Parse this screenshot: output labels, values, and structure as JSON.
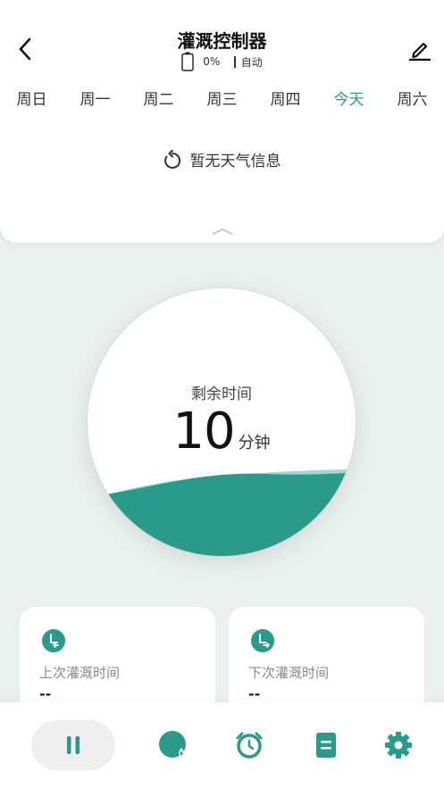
{
  "header": {
    "title": "灌溉控制器",
    "battery": "0%",
    "mode": "自动"
  },
  "days": [
    {
      "label": "周日",
      "active": false
    },
    {
      "label": "周一",
      "active": false
    },
    {
      "label": "周二",
      "active": false
    },
    {
      "label": "周三",
      "active": false
    },
    {
      "label": "周四",
      "active": false
    },
    {
      "label": "今天",
      "active": true
    },
    {
      "label": "周六",
      "active": false
    }
  ],
  "weather": {
    "text": "暂无天气信息"
  },
  "dial": {
    "label": "剩余时间",
    "value": "10",
    "unit": "分钟"
  },
  "cards": {
    "last": {
      "label": "上次灌溉时间",
      "value": "--"
    },
    "next": {
      "label": "下次灌溉时间",
      "value": "--"
    }
  },
  "icons": {
    "back": "chevron-left-icon",
    "edit": "pencil-icon",
    "battery": "battery-icon",
    "refresh": "refresh-icon",
    "collapse": "chevron-up-icon",
    "last_time": "clock-back-icon",
    "next_time": "clock-forward-icon",
    "pause": "pause-icon",
    "water": "water-drop-icon",
    "alarm": "alarm-clock-icon",
    "log": "document-icon",
    "settings": "gear-icon"
  },
  "colors": {
    "accent": "#2a9a8a",
    "background": "#e9f0ee",
    "card": "#ffffff"
  }
}
